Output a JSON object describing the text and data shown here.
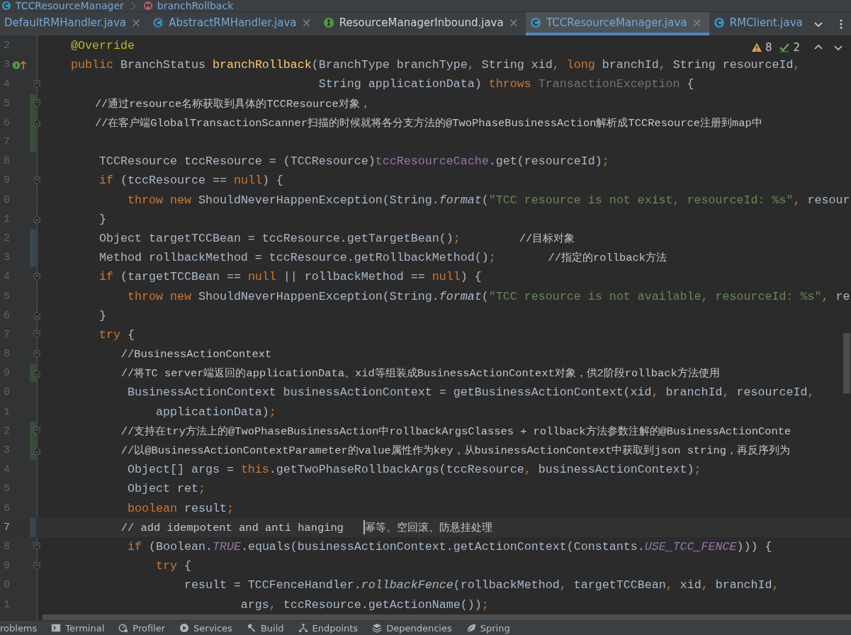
{
  "breadcrumb": [
    {
      "label": "TCCResourceManager",
      "kind": "class"
    },
    {
      "label": "branchRollback",
      "kind": "method"
    }
  ],
  "tabs": [
    {
      "label": "DefaultRMHandler.java",
      "kind": "none",
      "modified": true,
      "selected": false,
      "close": "×"
    },
    {
      "label": "AbstractRMHandler.java",
      "kind": "abstract",
      "modified": true,
      "selected": false,
      "close": "×"
    },
    {
      "label": "ResourceManagerInbound.java",
      "kind": "interface",
      "modified": false,
      "selected": false,
      "close": "×"
    },
    {
      "label": "TCCResourceManager.java",
      "kind": "class",
      "modified": true,
      "selected": true,
      "close": "×"
    },
    {
      "label": "RMClient.java",
      "kind": "class",
      "modified": true,
      "selected": false
    }
  ],
  "inspections": {
    "warnings": "8",
    "weak_warnings": "2"
  },
  "lines": [
    {
      "n": "2",
      "current": false,
      "added": false,
      "modified": false,
      "fold_start": false,
      "fold_end": false,
      "overrides": false,
      "tokens": [
        {
          "text": "    @Override",
          "kind": "annotation"
        }
      ]
    },
    {
      "n": "3",
      "current": false,
      "added": false,
      "modified": false,
      "fold_start": false,
      "fold_end": false,
      "overrides": true,
      "tokens": [
        {
          "text": "    public ",
          "kind": "keyword"
        },
        {
          "text": "BranchStatus ",
          "kind": "plain"
        },
        {
          "text": "branchRollback",
          "kind": "decl"
        },
        {
          "text": "(BranchType branchType",
          "kind": "plain"
        },
        {
          "text": ", ",
          "kind": "keyword"
        },
        {
          "text": "String xid",
          "kind": "plain"
        },
        {
          "text": ", ",
          "kind": "keyword"
        },
        {
          "text": "long ",
          "kind": "keyword"
        },
        {
          "text": "branchId",
          "kind": "plain"
        },
        {
          "text": ", ",
          "kind": "keyword"
        },
        {
          "text": "String resourceId",
          "kind": "plain"
        },
        {
          "text": ",",
          "kind": "keyword"
        }
      ]
    },
    {
      "n": "4",
      "current": false,
      "added": false,
      "modified": false,
      "fold_start": true,
      "fold_end": false,
      "overrides": false,
      "tokens": [
        {
          "text": "                                       String applicationData) ",
          "kind": "plain"
        },
        {
          "text": "throws ",
          "kind": "keyword"
        },
        {
          "text": "TransactionException ",
          "kind": "unused"
        },
        {
          "text": "{",
          "kind": "plain"
        }
      ]
    },
    {
      "n": "5",
      "current": false,
      "added": true,
      "modified": false,
      "fold_start": true,
      "fold_end": false,
      "overrides": false,
      "tokens": [
        {
          "text": "        //通过resource名称获取到具体的TCCResource对象，",
          "kind": "comment"
        }
      ]
    },
    {
      "n": "6",
      "current": false,
      "added": true,
      "modified": false,
      "fold_start": false,
      "fold_end": true,
      "overrides": false,
      "tokens": [
        {
          "text": "        //在客户端GlobalTransactionScanner扫描的时候就将各分支方法的@TwoPhaseBusinessAction解析成TCCResource注册到map中",
          "kind": "comment"
        }
      ]
    },
    {
      "n": "7",
      "current": false,
      "added": true,
      "modified": false,
      "fold_start": false,
      "fold_end": false,
      "overrides": false
    },
    {
      "n": "8",
      "current": false,
      "added": false,
      "modified": false,
      "fold_start": false,
      "fold_end": false,
      "overrides": false,
      "tokens": [
        {
          "text": "        TCCResource tccResource = (TCCResource)",
          "kind": "plain"
        },
        {
          "text": "tccResourceCache",
          "kind": "field"
        },
        {
          "text": ".get(resourceId)",
          "kind": "plain"
        },
        {
          "text": ";",
          "kind": "keyword"
        }
      ]
    },
    {
      "n": "9",
      "current": false,
      "added": false,
      "modified": false,
      "fold_start": true,
      "fold_end": false,
      "overrides": false,
      "tokens": [
        {
          "text": "        if ",
          "kind": "keyword"
        },
        {
          "text": "(tccResource == ",
          "kind": "plain"
        },
        {
          "text": "null",
          "kind": "keyword"
        },
        {
          "text": ") {",
          "kind": "plain"
        }
      ]
    },
    {
      "n": "0",
      "current": false,
      "added": false,
      "modified": false,
      "fold_start": false,
      "fold_end": false,
      "overrides": false,
      "tokens": [
        {
          "text": "            throw new ",
          "kind": "keyword"
        },
        {
          "text": "ShouldNeverHappenException(String.",
          "kind": "plain"
        },
        {
          "text": "format",
          "kind": "static"
        },
        {
          "text": "(",
          "kind": "plain"
        },
        {
          "text": "\"TCC resource is not exist, resourceId: %s\"",
          "kind": "string"
        },
        {
          "text": ", ",
          "kind": "keyword"
        },
        {
          "text": "resour",
          "kind": "plain"
        }
      ]
    },
    {
      "n": "1",
      "current": false,
      "added": false,
      "modified": false,
      "fold_start": false,
      "fold_end": true,
      "overrides": false,
      "tokens": [
        {
          "text": "        }",
          "kind": "plain"
        }
      ]
    },
    {
      "n": "2",
      "current": false,
      "added": false,
      "modified": true,
      "fold_start": false,
      "fold_end": false,
      "overrides": false,
      "tokens": [
        {
          "text": "        Object targetTCCBean = tccResource.getTargetBean()",
          "kind": "plain"
        },
        {
          "text": ";",
          "kind": "keyword"
        },
        {
          "text": "         //目标对象",
          "kind": "comment"
        }
      ]
    },
    {
      "n": "3",
      "current": false,
      "added": false,
      "modified": true,
      "fold_start": false,
      "fold_end": false,
      "overrides": false,
      "tokens": [
        {
          "text": "        Method rollbackMethod = tccResource.getRollbackMethod()",
          "kind": "plain"
        },
        {
          "text": ";",
          "kind": "keyword"
        },
        {
          "text": "        //指定的rollback方法",
          "kind": "comment"
        }
      ]
    },
    {
      "n": "4",
      "current": false,
      "added": false,
      "modified": false,
      "fold_start": true,
      "fold_end": false,
      "overrides": false,
      "tokens": [
        {
          "text": "        if ",
          "kind": "keyword"
        },
        {
          "text": "(targetTCCBean == ",
          "kind": "plain"
        },
        {
          "text": "null ",
          "kind": "keyword"
        },
        {
          "text": "|| rollbackMethod == ",
          "kind": "plain"
        },
        {
          "text": "null",
          "kind": "keyword"
        },
        {
          "text": ") {",
          "kind": "plain"
        }
      ]
    },
    {
      "n": "5",
      "current": false,
      "added": false,
      "modified": false,
      "fold_start": false,
      "fold_end": false,
      "overrides": false,
      "tokens": [
        {
          "text": "            throw new ",
          "kind": "keyword"
        },
        {
          "text": "ShouldNeverHappenException(String.",
          "kind": "plain"
        },
        {
          "text": "format",
          "kind": "static"
        },
        {
          "text": "(",
          "kind": "plain"
        },
        {
          "text": "\"TCC resource is not available, resourceId: %s\"",
          "kind": "string"
        },
        {
          "text": ", ",
          "kind": "keyword"
        },
        {
          "text": "re",
          "kind": "plain"
        }
      ]
    },
    {
      "n": "6",
      "current": false,
      "added": false,
      "modified": false,
      "fold_start": false,
      "fold_end": true,
      "overrides": false,
      "tokens": [
        {
          "text": "        }",
          "kind": "plain"
        }
      ]
    },
    {
      "n": "7",
      "current": false,
      "added": false,
      "modified": false,
      "fold_start": true,
      "fold_end": false,
      "overrides": false,
      "tokens": [
        {
          "text": "        try ",
          "kind": "keyword"
        },
        {
          "text": "{",
          "kind": "plain"
        }
      ]
    },
    {
      "n": "8",
      "current": false,
      "added": false,
      "modified": false,
      "fold_start": true,
      "fold_end": false,
      "overrides": false,
      "tokens": [
        {
          "text": "            //BusinessActionContext",
          "kind": "comment"
        }
      ]
    },
    {
      "n": "9",
      "current": false,
      "added": true,
      "modified": false,
      "fold_start": false,
      "fold_end": true,
      "overrides": false,
      "tokens": [
        {
          "text": "            //将TC server端返回的applicationData、xid等组装成BusinessActionContext对象，供2阶段rollback方法使用",
          "kind": "comment"
        }
      ]
    },
    {
      "n": "0",
      "current": false,
      "added": false,
      "modified": false,
      "fold_start": false,
      "fold_end": false,
      "overrides": false,
      "tokens": [
        {
          "text": "            BusinessActionContext businessActionContext = getBusinessActionContext(xid",
          "kind": "plain"
        },
        {
          "text": ", ",
          "kind": "keyword"
        },
        {
          "text": "branchId",
          "kind": "plain"
        },
        {
          "text": ", ",
          "kind": "keyword"
        },
        {
          "text": "resourceId",
          "kind": "plain"
        },
        {
          "text": ",",
          "kind": "keyword"
        }
      ]
    },
    {
      "n": "1",
      "current": false,
      "added": false,
      "modified": false,
      "fold_start": false,
      "fold_end": false,
      "overrides": false,
      "tokens": [
        {
          "text": "                applicationData)",
          "kind": "plain"
        },
        {
          "text": ";",
          "kind": "keyword"
        }
      ]
    },
    {
      "n": "2",
      "current": false,
      "added": true,
      "modified": false,
      "fold_start": true,
      "fold_end": false,
      "overrides": false,
      "tokens": [
        {
          "text": "            //支持在try方法上的@TwoPhaseBusinessAction中rollbackArgsClasses + rollback方法参数注解的@BusinessActionConte",
          "kind": "comment"
        }
      ]
    },
    {
      "n": "3",
      "current": false,
      "added": true,
      "modified": false,
      "fold_start": false,
      "fold_end": true,
      "overrides": false,
      "tokens": [
        {
          "text": "            //以@BusinessActionContextParameter的value属性作为key，从businessActionContext中获取到json string，再反序列为",
          "kind": "comment"
        }
      ]
    },
    {
      "n": "4",
      "current": false,
      "added": false,
      "modified": false,
      "fold_start": false,
      "fold_end": false,
      "overrides": false,
      "tokens": [
        {
          "text": "            Object[] args = ",
          "kind": "plain"
        },
        {
          "text": "this",
          "kind": "keyword"
        },
        {
          "text": ".getTwoPhaseRollbackArgs(tccResource",
          "kind": "plain"
        },
        {
          "text": ", ",
          "kind": "keyword"
        },
        {
          "text": "businessActionContext)",
          "kind": "plain"
        },
        {
          "text": ";",
          "kind": "keyword"
        }
      ]
    },
    {
      "n": "5",
      "current": false,
      "added": false,
      "modified": false,
      "fold_start": false,
      "fold_end": false,
      "overrides": false,
      "tokens": [
        {
          "text": "            Object ret",
          "kind": "plain"
        },
        {
          "text": ";",
          "kind": "keyword"
        }
      ]
    },
    {
      "n": "6",
      "current": false,
      "added": false,
      "modified": false,
      "fold_start": false,
      "fold_end": false,
      "overrides": false,
      "tokens": [
        {
          "text": "            boolean ",
          "kind": "keyword"
        },
        {
          "text": "result",
          "kind": "plain"
        },
        {
          "text": ";",
          "kind": "keyword"
        }
      ]
    },
    {
      "n": "7",
      "current": true,
      "added": false,
      "modified": true,
      "fold_start": false,
      "fold_end": false,
      "overrides": false,
      "tokens": [
        {
          "text": "            // add idempotent and anti hanging   ",
          "kind": "comment"
        },
        {
          "kind": "caret"
        },
        {
          "text": "幂等、空回滚、防悬挂处理",
          "kind": "comment"
        }
      ]
    },
    {
      "n": "8",
      "current": false,
      "added": false,
      "modified": false,
      "fold_start": true,
      "fold_end": false,
      "overrides": false,
      "tokens": [
        {
          "text": "            if ",
          "kind": "keyword"
        },
        {
          "text": "(Boolean.",
          "kind": "plain"
        },
        {
          "text": "TRUE",
          "kind": "constant"
        },
        {
          "text": ".equals(businessActionContext.getActionContext(Constants.",
          "kind": "plain"
        },
        {
          "text": "USE_TCC_FENCE",
          "kind": "constant"
        },
        {
          "text": "))) {",
          "kind": "plain"
        }
      ]
    },
    {
      "n": "9",
      "current": false,
      "added": false,
      "modified": false,
      "fold_start": true,
      "fold_end": false,
      "overrides": false,
      "tokens": [
        {
          "text": "                try ",
          "kind": "keyword"
        },
        {
          "text": "{",
          "kind": "plain"
        }
      ]
    },
    {
      "n": "0",
      "current": false,
      "added": false,
      "modified": false,
      "fold_start": false,
      "fold_end": false,
      "overrides": false,
      "tokens": [
        {
          "text": "                    result = TCCFenceHandler.",
          "kind": "plain"
        },
        {
          "text": "rollbackFence",
          "kind": "static"
        },
        {
          "text": "(rollbackMethod",
          "kind": "plain"
        },
        {
          "text": ", ",
          "kind": "keyword"
        },
        {
          "text": "targetTCCBean",
          "kind": "plain"
        },
        {
          "text": ", ",
          "kind": "keyword"
        },
        {
          "text": "xid",
          "kind": "plain"
        },
        {
          "text": ", ",
          "kind": "keyword"
        },
        {
          "text": "branchId",
          "kind": "plain"
        },
        {
          "text": ",",
          "kind": "keyword"
        }
      ]
    },
    {
      "n": "1",
      "current": false,
      "added": false,
      "modified": false,
      "fold_start": false,
      "fold_end": false,
      "overrides": false,
      "tokens": [
        {
          "text": "                            args",
          "kind": "plain"
        },
        {
          "text": ", ",
          "kind": "keyword"
        },
        {
          "text": "tccResource.getActionName())",
          "kind": "plain"
        },
        {
          "text": ";",
          "kind": "keyword"
        }
      ]
    }
  ],
  "toolwindows": [
    {
      "label": "roblems",
      "kind": "none"
    },
    {
      "label": "Terminal",
      "kind": "terminal"
    },
    {
      "label": "Profiler",
      "kind": "profiler"
    },
    {
      "label": "Services",
      "kind": "services"
    },
    {
      "label": "Build",
      "kind": "build"
    },
    {
      "label": "Endpoints",
      "kind": "endpoints"
    },
    {
      "label": "Dependencies",
      "kind": "dependencies"
    },
    {
      "label": "Spring",
      "kind": "spring"
    }
  ]
}
